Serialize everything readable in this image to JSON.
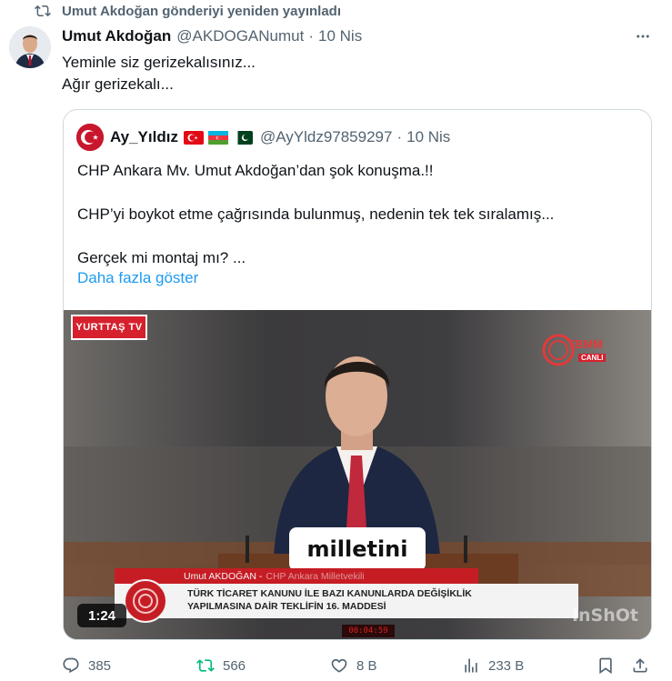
{
  "repost": {
    "icon": "repost-icon",
    "text": "Umut Akdoğan gönderiyi yeniden yayınladı"
  },
  "tweet": {
    "name": "Umut Akdoğan",
    "handle": "@AKDOGANumut",
    "separator": "·",
    "time": "10 Nis",
    "lines": [
      "Yeminle siz gerizekalısınız...",
      "Ağır gerizekalı..."
    ],
    "more_icon": "more-icon"
  },
  "quote": {
    "name": "Ay_Yıldız",
    "flags": [
      "turkey-flag-icon",
      "azerbaijan-flag-icon",
      "pakistan-flag-icon"
    ],
    "handle": "@AyYldz97859297",
    "separator": "·",
    "time": "10 Nis",
    "paragraphs": [
      "CHP Ankara Mv. Umut Akdoğan’dan şok konuşma.!!",
      "",
      "CHP’yi boykot etme çağrısında bulunmuş, nedenin tek tek sıralamış...",
      "",
      "Gerçek mi montaj mı? ..."
    ],
    "show_more": "Daha fazla göster",
    "video": {
      "channel_logo": "YURTTAŞ TV",
      "tbmm_logo": "TBMM",
      "tbmm_live": "CANLI",
      "caption": "milletini",
      "lower_name": "Umut AKDOĞAN -",
      "lower_name_tail": "CHP Ankara Milletvekili",
      "lower_line1": "TÜRK TİCARET KANUNU İLE BAZI KANUNLARDA DEĞİŞİKLİK",
      "lower_line2": "YAPILMASINA DAİR TEKLİFİN 16. MADDESİ",
      "duration": "1:24",
      "watermark": "InShOt",
      "clock": "00:04:59"
    }
  },
  "actions": {
    "reply": {
      "icon": "reply-icon",
      "count": "385"
    },
    "repost": {
      "icon": "repost-icon",
      "count": "566",
      "color": "#00ba7c"
    },
    "like": {
      "icon": "heart-icon",
      "count": "8 B"
    },
    "views": {
      "icon": "views-chart-icon",
      "count": "233 B"
    },
    "bookmark": {
      "icon": "bookmark-icon"
    },
    "share": {
      "icon": "share-icon"
    }
  }
}
